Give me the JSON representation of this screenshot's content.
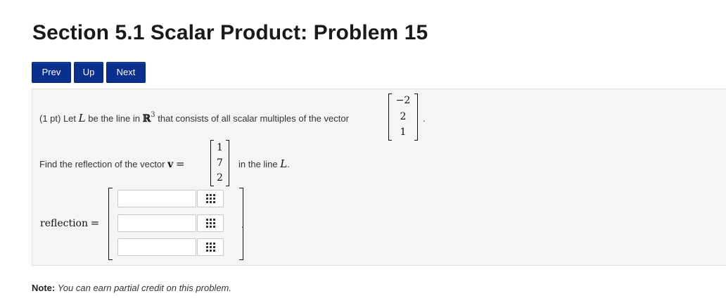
{
  "page": {
    "title": "Section 5.1 Scalar Product: Problem 15"
  },
  "nav": {
    "prev_label": "Prev",
    "up_label": "Up",
    "next_label": "Next",
    "button_color": "#0a2f8c"
  },
  "problem": {
    "points": "(1 pt) Let",
    "line_symbol": "L",
    "be_the_line_in": "be the line in",
    "space_symbol": "ℝ",
    "space_exponent": "3",
    "consists_text": "that consists of all scalar multiples of the vector",
    "direction_vector": [
      "−2",
      "2",
      "1"
    ],
    "period": ".",
    "find_text": "Find the reflection of the vector",
    "v_symbol": "v",
    "equals": "=",
    "input_vector": [
      "1",
      "7",
      "2"
    ],
    "in_the_line_text": "in the line",
    "answer_label": "reflection",
    "answers": [
      {
        "value": "",
        "placeholder": ""
      },
      {
        "value": "",
        "placeholder": ""
      },
      {
        "value": "",
        "placeholder": ""
      }
    ]
  },
  "note": {
    "label": "Note:",
    "text": "You can earn partial credit on this problem."
  }
}
